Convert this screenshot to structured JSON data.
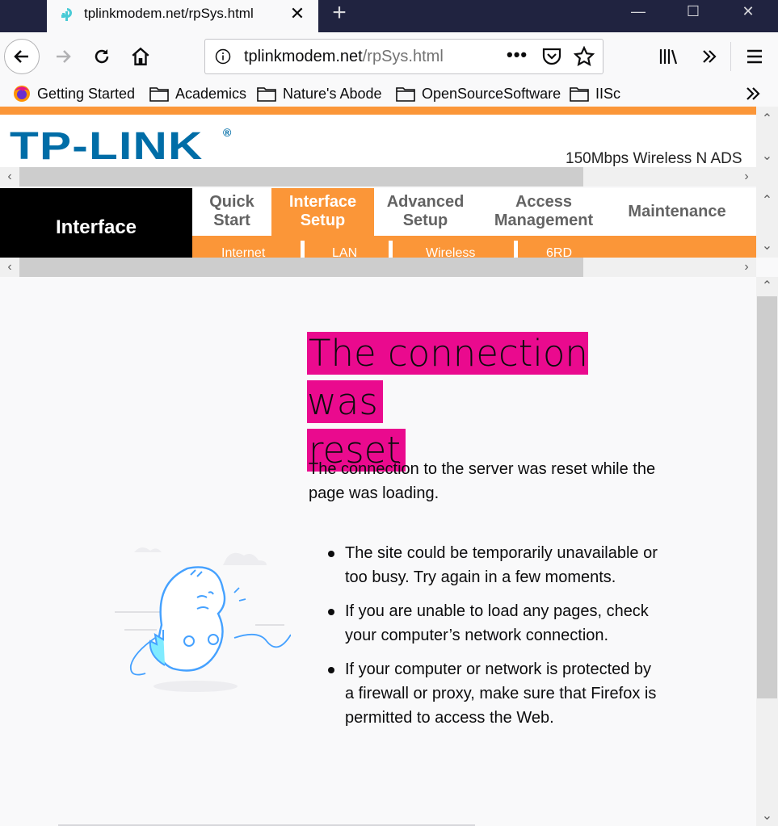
{
  "tab": {
    "title": "tplinkmodem.net/rpSys.html",
    "close": "✕",
    "new_tab": "+"
  },
  "window": {
    "minimize": "—",
    "maximize": "☐",
    "close": "✕"
  },
  "urlbar": {
    "host": "tplinkmodem.net",
    "path": "/rpSys.html",
    "more": "•••"
  },
  "bookmarks": [
    {
      "label": "Getting Started",
      "icon": "firefox-icon"
    },
    {
      "label": "Academics",
      "icon": "folder-icon"
    },
    {
      "label": "Nature's Abode",
      "icon": "folder-icon"
    },
    {
      "label": "OpenSourceSoftware",
      "icon": "folder-icon"
    },
    {
      "label": "IISc",
      "icon": "folder-icon"
    }
  ],
  "router": {
    "logo": "TP-LINK",
    "logo_mark": "®",
    "product": "150Mbps Wireless N ADS",
    "section": "Interface",
    "menu": [
      {
        "line1": "Quick",
        "line2": "Start"
      },
      {
        "line1": "Interface",
        "line2": "Setup"
      },
      {
        "line1": "Advanced",
        "line2": "Setup"
      },
      {
        "line1": "Access",
        "line2": "Management"
      },
      {
        "line1": "Maintenance",
        "line2": ""
      }
    ],
    "submenu": [
      "Internet",
      "LAN",
      "Wireless",
      "6RD"
    ],
    "colors": {
      "brand": "#006da7",
      "accent": "#fb9638"
    }
  },
  "error": {
    "title_line1": "The connection was",
    "title_line2": "reset",
    "description": "The connection to the server was reset while the page was loading.",
    "bullets": [
      "The site could be temporarily unavailable or too busy. Try again in a few moments.",
      "If you are unable to load any pages, check your computer’s network connection.",
      "If your computer or network is protected by a firewall or proxy, make sure that Firefox is permitted to access the Web."
    ],
    "highlight_color": "#ea0a8e"
  }
}
